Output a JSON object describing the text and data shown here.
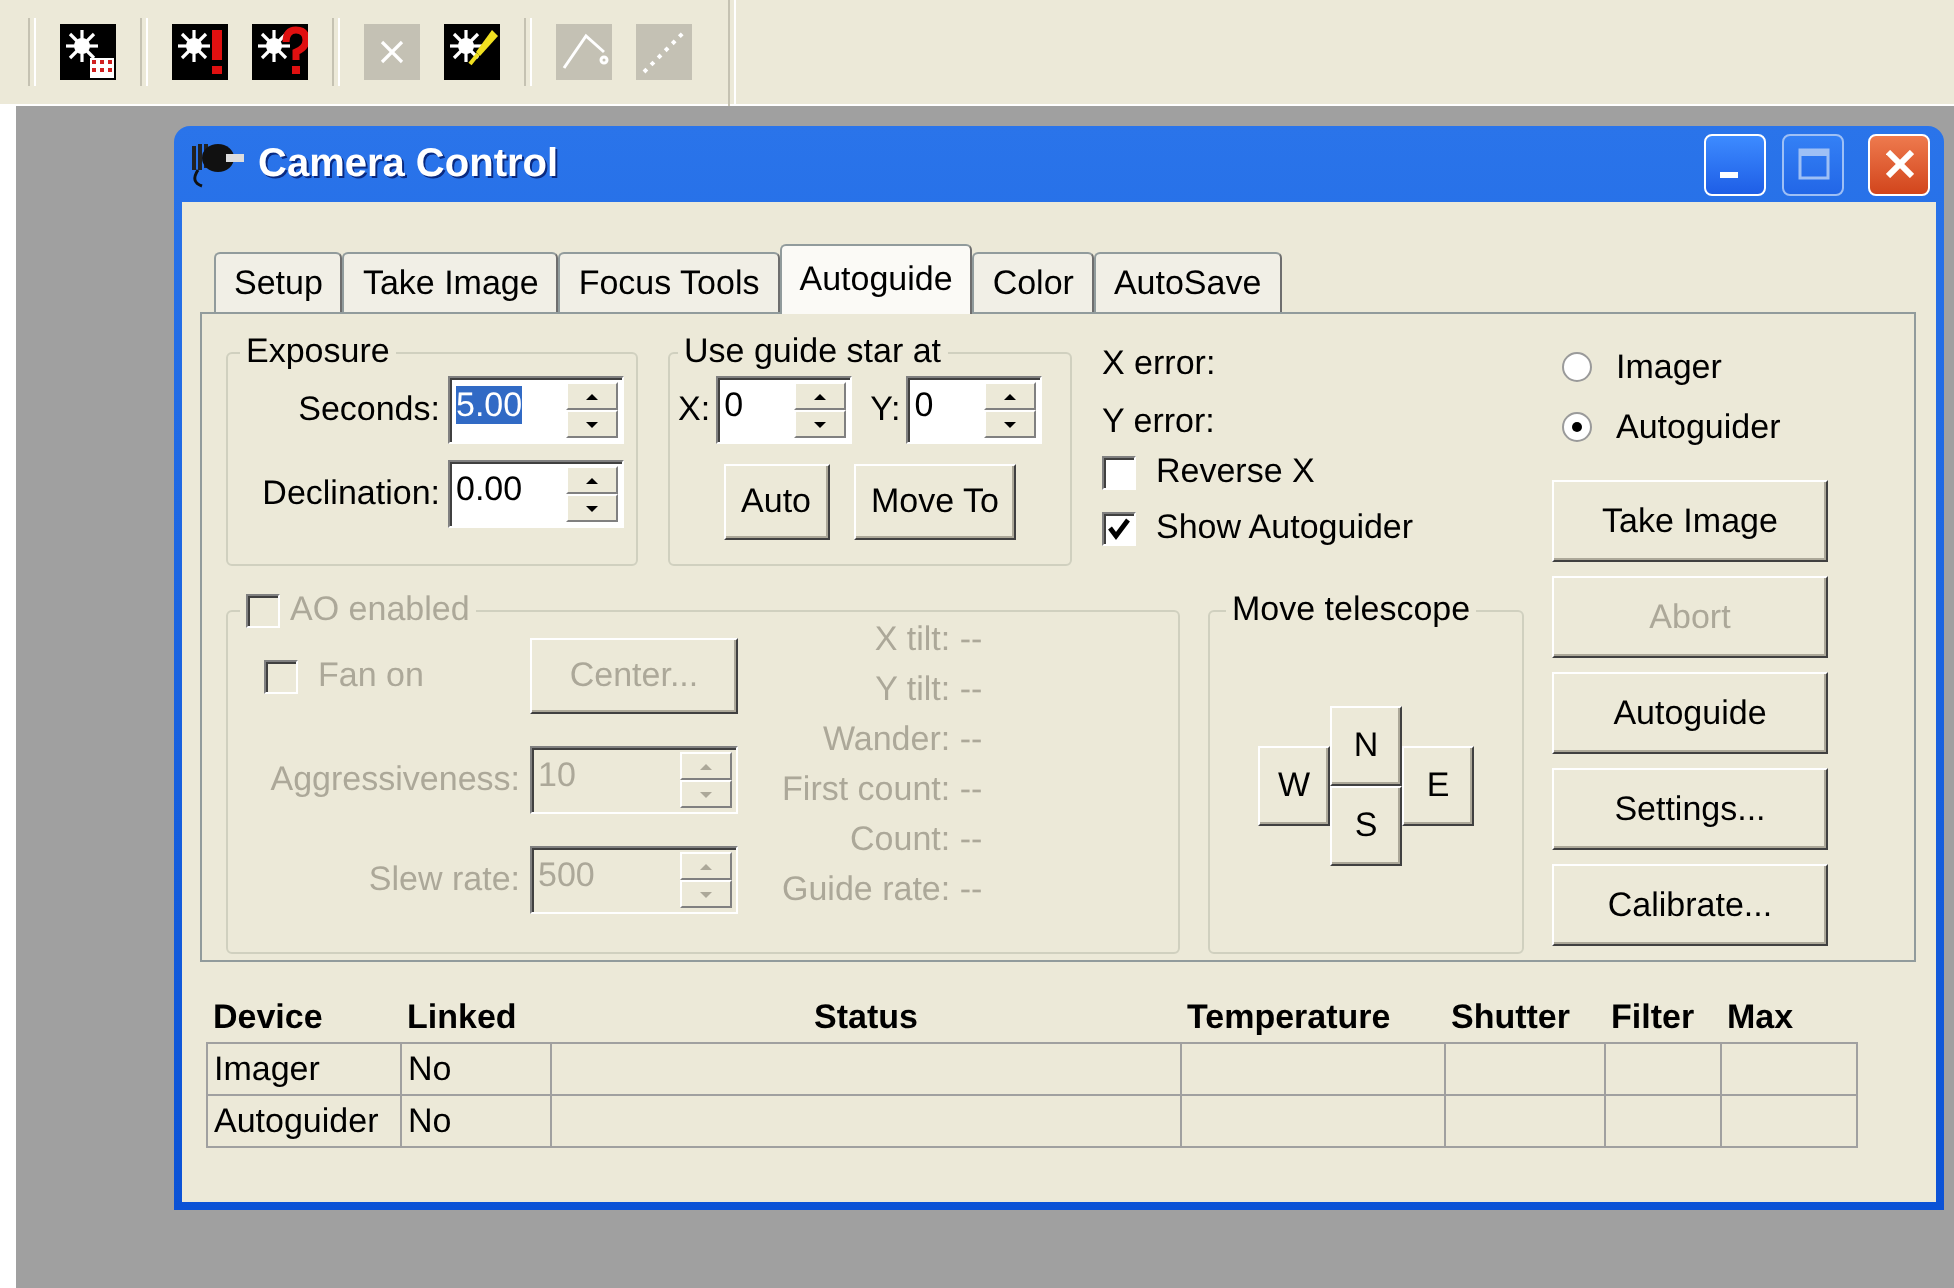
{
  "toolbar": {
    "groups": [
      [
        {
          "kind": "star-grid",
          "disabled": false
        }
      ],
      [
        {
          "kind": "star-exclamation",
          "disabled": false
        },
        {
          "kind": "star-question",
          "disabled": false
        }
      ],
      [
        {
          "kind": "cross",
          "disabled": true
        },
        {
          "kind": "star-pin",
          "disabled": false
        }
      ],
      [
        {
          "kind": "angle",
          "disabled": true
        },
        {
          "kind": "dotted-line",
          "disabled": true
        }
      ]
    ]
  },
  "window": {
    "title": "Camera Control",
    "controls": [
      {
        "kind": "minimize",
        "disabled": false
      },
      {
        "kind": "maximize",
        "disabled": true
      },
      {
        "kind": "close",
        "disabled": false
      }
    ]
  },
  "tabs": [
    {
      "label": "Setup",
      "selected": false
    },
    {
      "label": "Take Image",
      "selected": false
    },
    {
      "label": "Focus Tools",
      "selected": false
    },
    {
      "label": "Autoguide",
      "selected": true
    },
    {
      "label": "Color",
      "selected": false
    },
    {
      "label": "AutoSave",
      "selected": false
    }
  ],
  "exposure": {
    "title": "Exposure",
    "fields": [
      {
        "label": "Seconds:",
        "value": "5.00",
        "selected": true
      },
      {
        "label": "Declination:",
        "value": "0.00",
        "selected": false
      }
    ]
  },
  "guide_star": {
    "title": "Use guide star at",
    "fields": [
      {
        "label": "X:",
        "value": "0"
      },
      {
        "label": "Y:",
        "value": "0"
      }
    ],
    "buttons": [
      "Auto",
      "Move To"
    ]
  },
  "errors": [
    "X error:",
    "Y error:"
  ],
  "options": [
    {
      "label": "Reverse X",
      "checked": false
    },
    {
      "label": "Show Autoguider",
      "checked": true
    }
  ],
  "camera": [
    {
      "label": "Imager",
      "selected": false
    },
    {
      "label": "Autoguider",
      "selected": true
    }
  ],
  "actions": [
    {
      "label": "Take Image",
      "disabled": false
    },
    {
      "label": "Abort",
      "disabled": true
    },
    {
      "label": "Autoguide",
      "disabled": false
    },
    {
      "label": "Settings...",
      "disabled": false
    },
    {
      "label": "Calibrate...",
      "disabled": false
    }
  ],
  "ao": {
    "label": "AO enabled",
    "checked": false,
    "disabled": true,
    "fan": {
      "label": "Fan on",
      "checked": false
    },
    "center_button": "Center...",
    "fields": [
      {
        "label": "Aggressiveness:",
        "value": "10"
      },
      {
        "label": "Slew rate:",
        "value": "500"
      }
    ],
    "readouts": [
      "X tilt: --",
      "Y tilt: --",
      "Wander: --",
      "First count: --",
      "Count: --",
      "Guide rate: --"
    ]
  },
  "move_telescope": {
    "title": "Move telescope",
    "north": "N",
    "west": "W",
    "east": "E",
    "south": "S"
  },
  "table": {
    "columns": [
      "Device",
      "Linked",
      "Status",
      "Temperature",
      "Shutter",
      "Filter",
      "Max"
    ],
    "rows": [
      {
        "device": "Imager",
        "linked": "No"
      },
      {
        "device": "Autoguider",
        "linked": "No"
      }
    ]
  }
}
